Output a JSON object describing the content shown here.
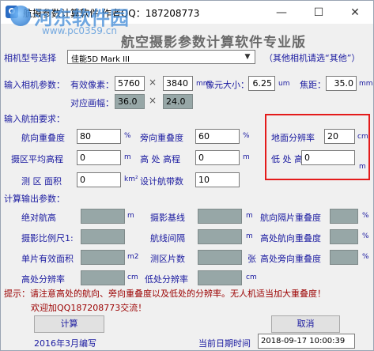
{
  "window": {
    "title": "航摄参数计算软件  作者QQ：187208773",
    "minimize": "—",
    "maximize": "☐",
    "close": "✕"
  },
  "watermark": {
    "title": "河东软件园",
    "url": "www.pc0359.cn"
  },
  "heading": "航空摄影参数计算软件专业版",
  "camera": {
    "label": "相机型号选择",
    "selected": "佳能5D Mark III",
    "note": "（其他相机请选“其他”）"
  },
  "camera_params": {
    "section_label": "输入相机参数：",
    "pixels_label": "有效像素：",
    "pixels_w": "5760",
    "pixels_h": "3840",
    "pixels_unit": "mm",
    "pixel_size_label": "像元大小：",
    "pixel_size": "6.25",
    "pixel_size_unit": "um",
    "focal_label": "焦距：",
    "focal": "35.0",
    "focal_unit": "mm",
    "frame_label": "对应画幅：",
    "frame_w": "36.0",
    "frame_h": "24.0"
  },
  "flight_params": {
    "section_label": "输入航拍要求：",
    "forward_overlap_label": "航向重叠度",
    "forward_overlap": "80",
    "forward_overlap_unit": "%",
    "side_overlap_label": "旁向重叠度",
    "side_overlap": "60",
    "side_overlap_unit": "%",
    "gsd_label": "地面分辨率",
    "gsd": "20",
    "gsd_unit": "cm",
    "avg_elev_label": "摄区平均高程",
    "avg_elev": "0",
    "avg_elev_unit": "m",
    "high_elev_label": "高 处 高程",
    "high_elev": "0",
    "high_elev_unit": "m",
    "low_elev_label": "低 处 高程",
    "low_elev": "0",
    "low_elev_unit": "m",
    "area_label": "测 区 面积",
    "area": "0",
    "area_unit": "km²",
    "strips_label": "设计航带数",
    "strips": "10"
  },
  "output": {
    "section_label": "计算输出参数：",
    "abs_height_label": "绝对航高",
    "abs_height_unit": "m",
    "baseline_label": "摄影基线",
    "baseline_unit": "m",
    "adj_forward_label": "航向隔片重叠度",
    "adj_forward_unit": "%",
    "scale_label": "摄影比例尺1:",
    "strip_spacing_label": "航线间隔",
    "strip_spacing_unit": "m",
    "high_forward_label": "高处航向重叠度",
    "high_forward_unit": "%",
    "photo_area_label": "单片有效面积",
    "photo_area_unit": "m2",
    "photo_count_label": "测区片数",
    "photo_count_unit": "张",
    "high_side_label": "高处旁向重叠度",
    "high_side_unit": "%",
    "high_gsd_label": "高处分辨率",
    "high_gsd_unit": "cm",
    "low_gsd_label": "低处分辨率",
    "low_gsd_unit": "cm"
  },
  "hint": {
    "line1": "提示：请注意高处的航向、旁向重叠度以及低处的分辨率。无人机适当加大重叠度！",
    "line2": "欢迎加QQ187208773交流！"
  },
  "footer": {
    "calc_button": "计算",
    "cancel_button": "取消",
    "written": "2016年3月编写",
    "date_label": "当前日期时间",
    "datetime": "2018-09-17 10:00:39"
  }
}
